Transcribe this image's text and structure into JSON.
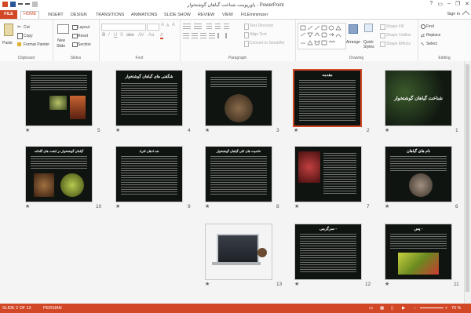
{
  "window": {
    "title": "پاورپوینت شناخت گیاهان گوشتخوار - PowerPoint",
    "sign_in": "Sign in",
    "help": "?"
  },
  "tabs": [
    "FILE",
    "HOME",
    "INSERT",
    "DESIGN",
    "TRANSITIONS",
    "ANIMATIONS",
    "SLIDE SHOW",
    "REVIEW",
    "VIEW",
    "FILEminimizer"
  ],
  "active_tab": "HOME",
  "ribbon": {
    "clipboard": {
      "paste": "Paste",
      "cut": "Cut",
      "copy": "Copy",
      "format_painter": "Format Painter",
      "label": "Clipboard"
    },
    "slides": {
      "new_slide": "New",
      "new_slide2": "Slide",
      "layout": "Layout",
      "reset": "Reset",
      "section": "Section",
      "label": "Slides"
    },
    "font": {
      "label": "Font"
    },
    "paragraph": {
      "text_direction": "Text Direction",
      "align_text": "Align Text",
      "convert": "Convert to SmartArt",
      "label": "Paragraph"
    },
    "drawing": {
      "arrange": "Arrange",
      "quick_styles": "Quick Styles",
      "shape_fill": "Shape Fill",
      "shape_outline": "Shape Outline",
      "shape_effects": "Shape Effects",
      "label": "Drawing"
    },
    "editing": {
      "find": "Find",
      "replace": "Replace",
      "select": "Select",
      "label": "Editing"
    }
  },
  "slides": [
    {
      "n": "1",
      "title": "شناخت گیاهان گوشتخوار"
    },
    {
      "n": "2",
      "title": "مقدمه"
    },
    {
      "n": "3",
      "title": ""
    },
    {
      "n": "4",
      "title": "شگفتی های گیاهان گوشتخوار"
    },
    {
      "n": "5",
      "title": ""
    },
    {
      "n": "6",
      "title": "نام های گیاهان"
    },
    {
      "n": "7",
      "title": ""
    },
    {
      "n": "8",
      "title": "خاصیت های کلی گیاهان گوشتخوار"
    },
    {
      "n": "9",
      "title": "شد اذهان افراد"
    },
    {
      "n": "10",
      "title": "گیاهان گوشتخوار در کشت های گلخانه"
    },
    {
      "n": "11",
      "title": "پس -"
    },
    {
      "n": "12",
      "title": "سرگرمی -"
    },
    {
      "n": "13",
      "title": ""
    }
  ],
  "status": {
    "slide": "SLIDE 2 OF 13",
    "language": "PERSIAN",
    "zoom": "70 %"
  }
}
